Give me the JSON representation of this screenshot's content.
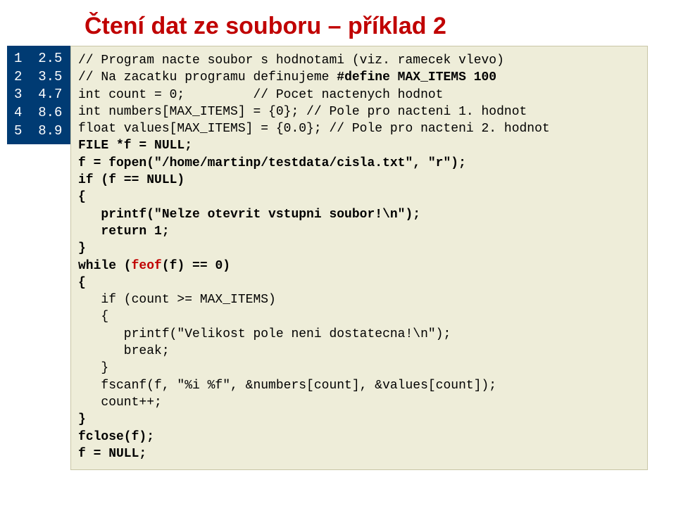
{
  "title": "Čtení dat ze souboru – příklad 2",
  "sidefile": "1  2.5\n2  3.5\n3  4.7\n4  8.6\n5  8.9",
  "code": {
    "l01": "// Program nacte soubor s hodnotami (viz. ramecek vlevo)",
    "l02a": "// Na zacatku programu definujeme ",
    "l02b": "#define MAX_ITEMS 100",
    "l03": "int count = 0;         // Pocet nactenych hodnot",
    "l04": "int numbers[MAX_ITEMS] = {0}; // Pole pro nacteni 1. hodnot",
    "l05": "float values[MAX_ITEMS] = {0.0}; // Pole pro nacteni 2. hodnot",
    "l06": "FILE *f = NULL;",
    "l07": "",
    "l08": "f = fopen(\"/home/martinp/testdata/cisla.txt\", \"r\");",
    "l09": "if (f == NULL)",
    "l10": "{",
    "l11": "   printf(\"Nelze otevrit vstupni soubor!\\n\");",
    "l12": "   return 1;",
    "l13": "}",
    "l14": "",
    "l15a": "while (",
    "l15b": "feof",
    "l15c": "(f) == 0)",
    "l16": "{",
    "l17": "   if (count >= MAX_ITEMS)",
    "l18": "   {",
    "l19": "      printf(\"Velikost pole neni dostatecna!\\n\");",
    "l20": "      break;",
    "l21": "   }",
    "l22": "   fscanf(f, \"%i %f\", &numbers[count], &values[count]);",
    "l23": "   count++;",
    "l24": "}",
    "l25": "",
    "l26": "fclose(f);",
    "l27": "f = NULL;"
  }
}
